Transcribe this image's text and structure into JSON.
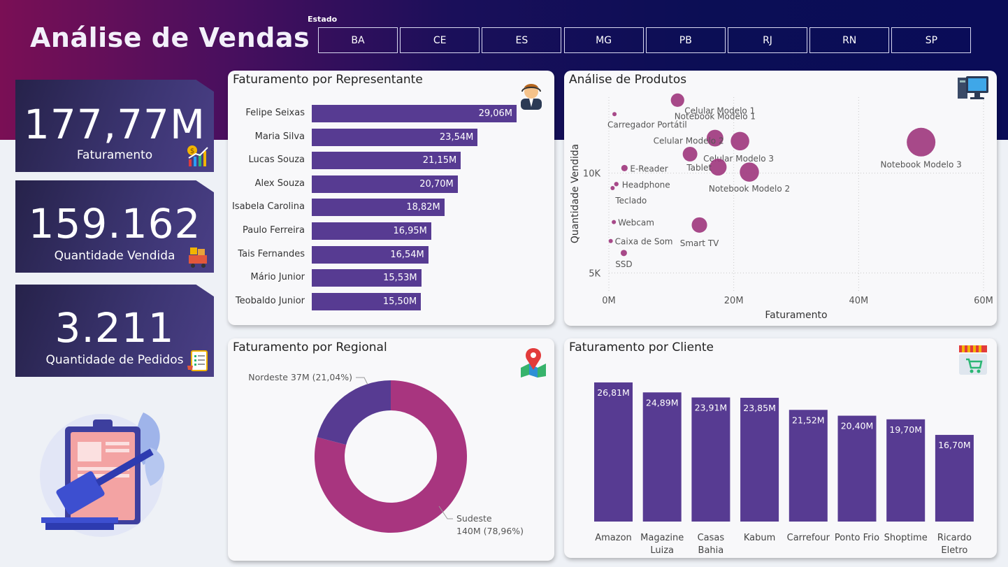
{
  "header": {
    "title": "Análise de Vendas",
    "filter_label": "Estado",
    "filters": [
      "BA",
      "CE",
      "ES",
      "MG",
      "PB",
      "RJ",
      "RN",
      "SP"
    ]
  },
  "kpis": [
    {
      "value": "177,77M",
      "label": "Faturamento",
      "icon": "revenue-chart-icon"
    },
    {
      "value": "159.162",
      "label": "Quantidade Vendida",
      "icon": "cart-boxes-icon"
    },
    {
      "value": "3.211",
      "label": "Quantidade de Pedidos",
      "icon": "order-list-icon"
    }
  ],
  "colors": {
    "bar": "#573b92",
    "bubble": "#a0397f",
    "donut_sudeste": "#a8357f",
    "donut_nordeste": "#573b92"
  },
  "chart_data": [
    {
      "id": "representante",
      "type": "bar",
      "orientation": "horizontal",
      "title": "Faturamento por Representante",
      "categories": [
        "Felipe Seixas",
        "Maria Silva",
        "Lucas Souza",
        "Alex Souza",
        "Isabela Carolina",
        "Paulo Ferreira",
        "Tais Fernandes",
        "Mário Junior",
        "Teobaldo Junior"
      ],
      "values": [
        29.06,
        23.54,
        21.15,
        20.7,
        18.82,
        16.95,
        16.54,
        15.53,
        15.5
      ],
      "data_labels": [
        "29,06M",
        "23,54M",
        "21,15M",
        "20,70M",
        "18,82M",
        "16,95M",
        "16,54M",
        "15,53M",
        "15,50M"
      ],
      "icon": "salesman-icon"
    },
    {
      "id": "produtos",
      "type": "scatter",
      "title": "Análise de Produtos",
      "xlabel": "Faturamento",
      "ylabel": "Quantidade Vendida",
      "x_ticks": [
        "0M",
        "20M",
        "40M",
        "60M"
      ],
      "y_ticks": [
        "5K",
        "10K"
      ],
      "xlim": [
        0,
        60
      ],
      "ylim": [
        4000,
        13800
      ],
      "grid": true,
      "icon": "computer-icon",
      "points": [
        {
          "label": "Notebook Modelo 3",
          "x": 50.0,
          "y": 11550,
          "size": 50
        },
        {
          "label": "Celular Modelo 1",
          "x": 11.0,
          "y": 13650,
          "size": 11
        },
        {
          "label": "Notebook Modelo 1",
          "x": 17.0,
          "y": 11750,
          "size": 17
        },
        {
          "label": "Celular Modelo 2",
          "x": 13.0,
          "y": 10950,
          "size": 13
        },
        {
          "label": "Celular Modelo 3",
          "x": 21.0,
          "y": 11600,
          "size": 21
        },
        {
          "label": "Tablet",
          "x": 17.5,
          "y": 10300,
          "size": 17.5
        },
        {
          "label": "Notebook Modelo 2",
          "x": 22.5,
          "y": 10050,
          "size": 22.5
        },
        {
          "label": "Carregador Portátil",
          "x": 0.9,
          "y": 12950,
          "size": 0.9
        },
        {
          "label": "E-Reader",
          "x": 2.5,
          "y": 10250,
          "size": 2.5
        },
        {
          "label": "Headphone",
          "x": 1.2,
          "y": 9450,
          "size": 1.2
        },
        {
          "label": "Teclado",
          "x": 0.6,
          "y": 9250,
          "size": 0.6
        },
        {
          "label": "Webcam",
          "x": 0.8,
          "y": 7550,
          "size": 0.8
        },
        {
          "label": "Smart TV",
          "x": 14.5,
          "y": 7400,
          "size": 14.5
        },
        {
          "label": "Caixa de Som",
          "x": 0.3,
          "y": 6600,
          "size": 0.3
        },
        {
          "label": "SSD",
          "x": 2.4,
          "y": 6000,
          "size": 2.4
        }
      ]
    },
    {
      "id": "regional",
      "type": "pie",
      "variant": "donut",
      "title": "Faturamento por Regional",
      "slices": [
        {
          "name": "Sudeste",
          "value": 140,
          "percent": 78.96,
          "label_line1": "Sudeste",
          "label_line2": "140M (78,96%)"
        },
        {
          "name": "Nordeste",
          "value": 37,
          "percent": 21.04,
          "label_line1": "Nordeste 37M (21,04%)",
          "label_line2": ""
        }
      ],
      "icon": "map-pin-icon"
    },
    {
      "id": "cliente",
      "type": "bar",
      "orientation": "vertical",
      "title": "Faturamento por Cliente",
      "categories": [
        [
          "Amazon"
        ],
        [
          "Magazine",
          "Luiza"
        ],
        [
          "Casas",
          "Bahia"
        ],
        [
          "Kabum"
        ],
        [
          "Carrefour"
        ],
        [
          "Ponto Frio"
        ],
        [
          "Shoptime"
        ],
        [
          "Ricardo",
          "Eletro"
        ]
      ],
      "values": [
        26.81,
        24.89,
        23.91,
        23.85,
        21.52,
        20.4,
        19.7,
        16.7
      ],
      "data_labels": [
        "26,81M",
        "24,89M",
        "23,91M",
        "23,85M",
        "21,52M",
        "20,40M",
        "19,70M",
        "16,70M"
      ],
      "icon": "store-icon"
    }
  ]
}
